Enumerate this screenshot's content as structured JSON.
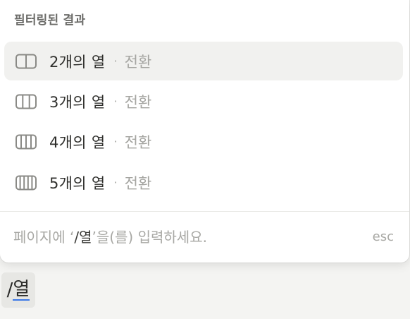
{
  "menu": {
    "title": "필터링된 결과",
    "options": [
      {
        "label": "2개의 열",
        "sub": "전환",
        "icon": "columns-2-icon",
        "selected": true
      },
      {
        "label": "3개의 열",
        "sub": "전환",
        "icon": "columns-3-icon",
        "selected": false
      },
      {
        "label": "4개의 열",
        "sub": "전환",
        "icon": "columns-4-icon",
        "selected": false
      },
      {
        "label": "5개의 열",
        "sub": "전환",
        "icon": "columns-5-icon",
        "selected": false
      }
    ],
    "separator": "·",
    "footer": {
      "hint_prefix": "페이지에 ‘",
      "hint_query": "/열",
      "hint_suffix": "’을(를) 입력하세요.",
      "esc_label": "esc"
    }
  },
  "editor": {
    "typed_slash": "/",
    "typed_composing": "열"
  },
  "colors": {
    "selected_bg": "#f1f1ef",
    "ime_underline": "#3b78e7"
  }
}
